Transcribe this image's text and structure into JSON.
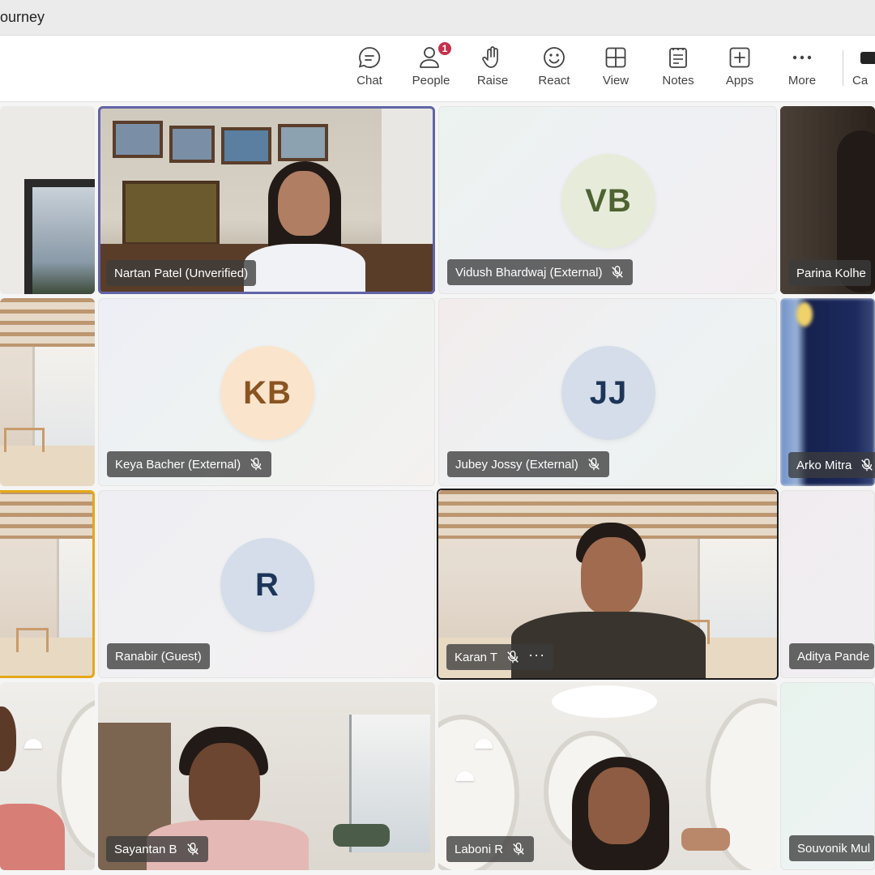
{
  "window": {
    "title": "ourney"
  },
  "toolbar": {
    "buttons": [
      {
        "id": "chat",
        "label": "Chat",
        "icon": "chat-icon"
      },
      {
        "id": "people",
        "label": "People",
        "icon": "people-icon",
        "badge": "1"
      },
      {
        "id": "raise",
        "label": "Raise",
        "icon": "raise-hand-icon"
      },
      {
        "id": "react",
        "label": "React",
        "icon": "smiley-icon"
      },
      {
        "id": "view",
        "label": "View",
        "icon": "grid-view-icon"
      },
      {
        "id": "notes",
        "label": "Notes",
        "icon": "notes-icon"
      },
      {
        "id": "apps",
        "label": "Apps",
        "icon": "add-apps-icon"
      },
      {
        "id": "more",
        "label": "More",
        "icon": "more-dots-icon"
      }
    ],
    "camera_label": "Ca"
  },
  "participants": {
    "nartan": {
      "name": "Nartan Patel (Unverified)",
      "muted": false
    },
    "vidush": {
      "name": "Vidush Bhardwaj (External)",
      "initials": "VB",
      "muted": true,
      "avatar_bg": "#e6ecd9",
      "avatar_fg": "#4e6232"
    },
    "parina": {
      "name": "Parina Kolhe"
    },
    "keya": {
      "name": "Keya Bacher (External)",
      "initials": "KB",
      "muted": true,
      "avatar_bg": "#fbe4cc",
      "avatar_fg": "#8a5421"
    },
    "jubey": {
      "name": "Jubey Jossy (External)",
      "initials": "JJ",
      "muted": true,
      "avatar_bg": "#d4dde9",
      "avatar_fg": "#1d3558"
    },
    "arko": {
      "name": "Arko Mitra"
    },
    "ranabir": {
      "name": "Ranabir (Guest)",
      "initials": "R",
      "muted": false,
      "avatar_bg": "#d4dde9",
      "avatar_fg": "#1d3558"
    },
    "karan": {
      "name": "Karan T",
      "muted": true
    },
    "aditya": {
      "name": "Aditya Pande"
    },
    "sayantan": {
      "name": "Sayantan B",
      "muted": true
    },
    "laboni": {
      "name": "Laboni R",
      "muted": true
    },
    "souvonik": {
      "name": "Souvonik Mul"
    }
  }
}
